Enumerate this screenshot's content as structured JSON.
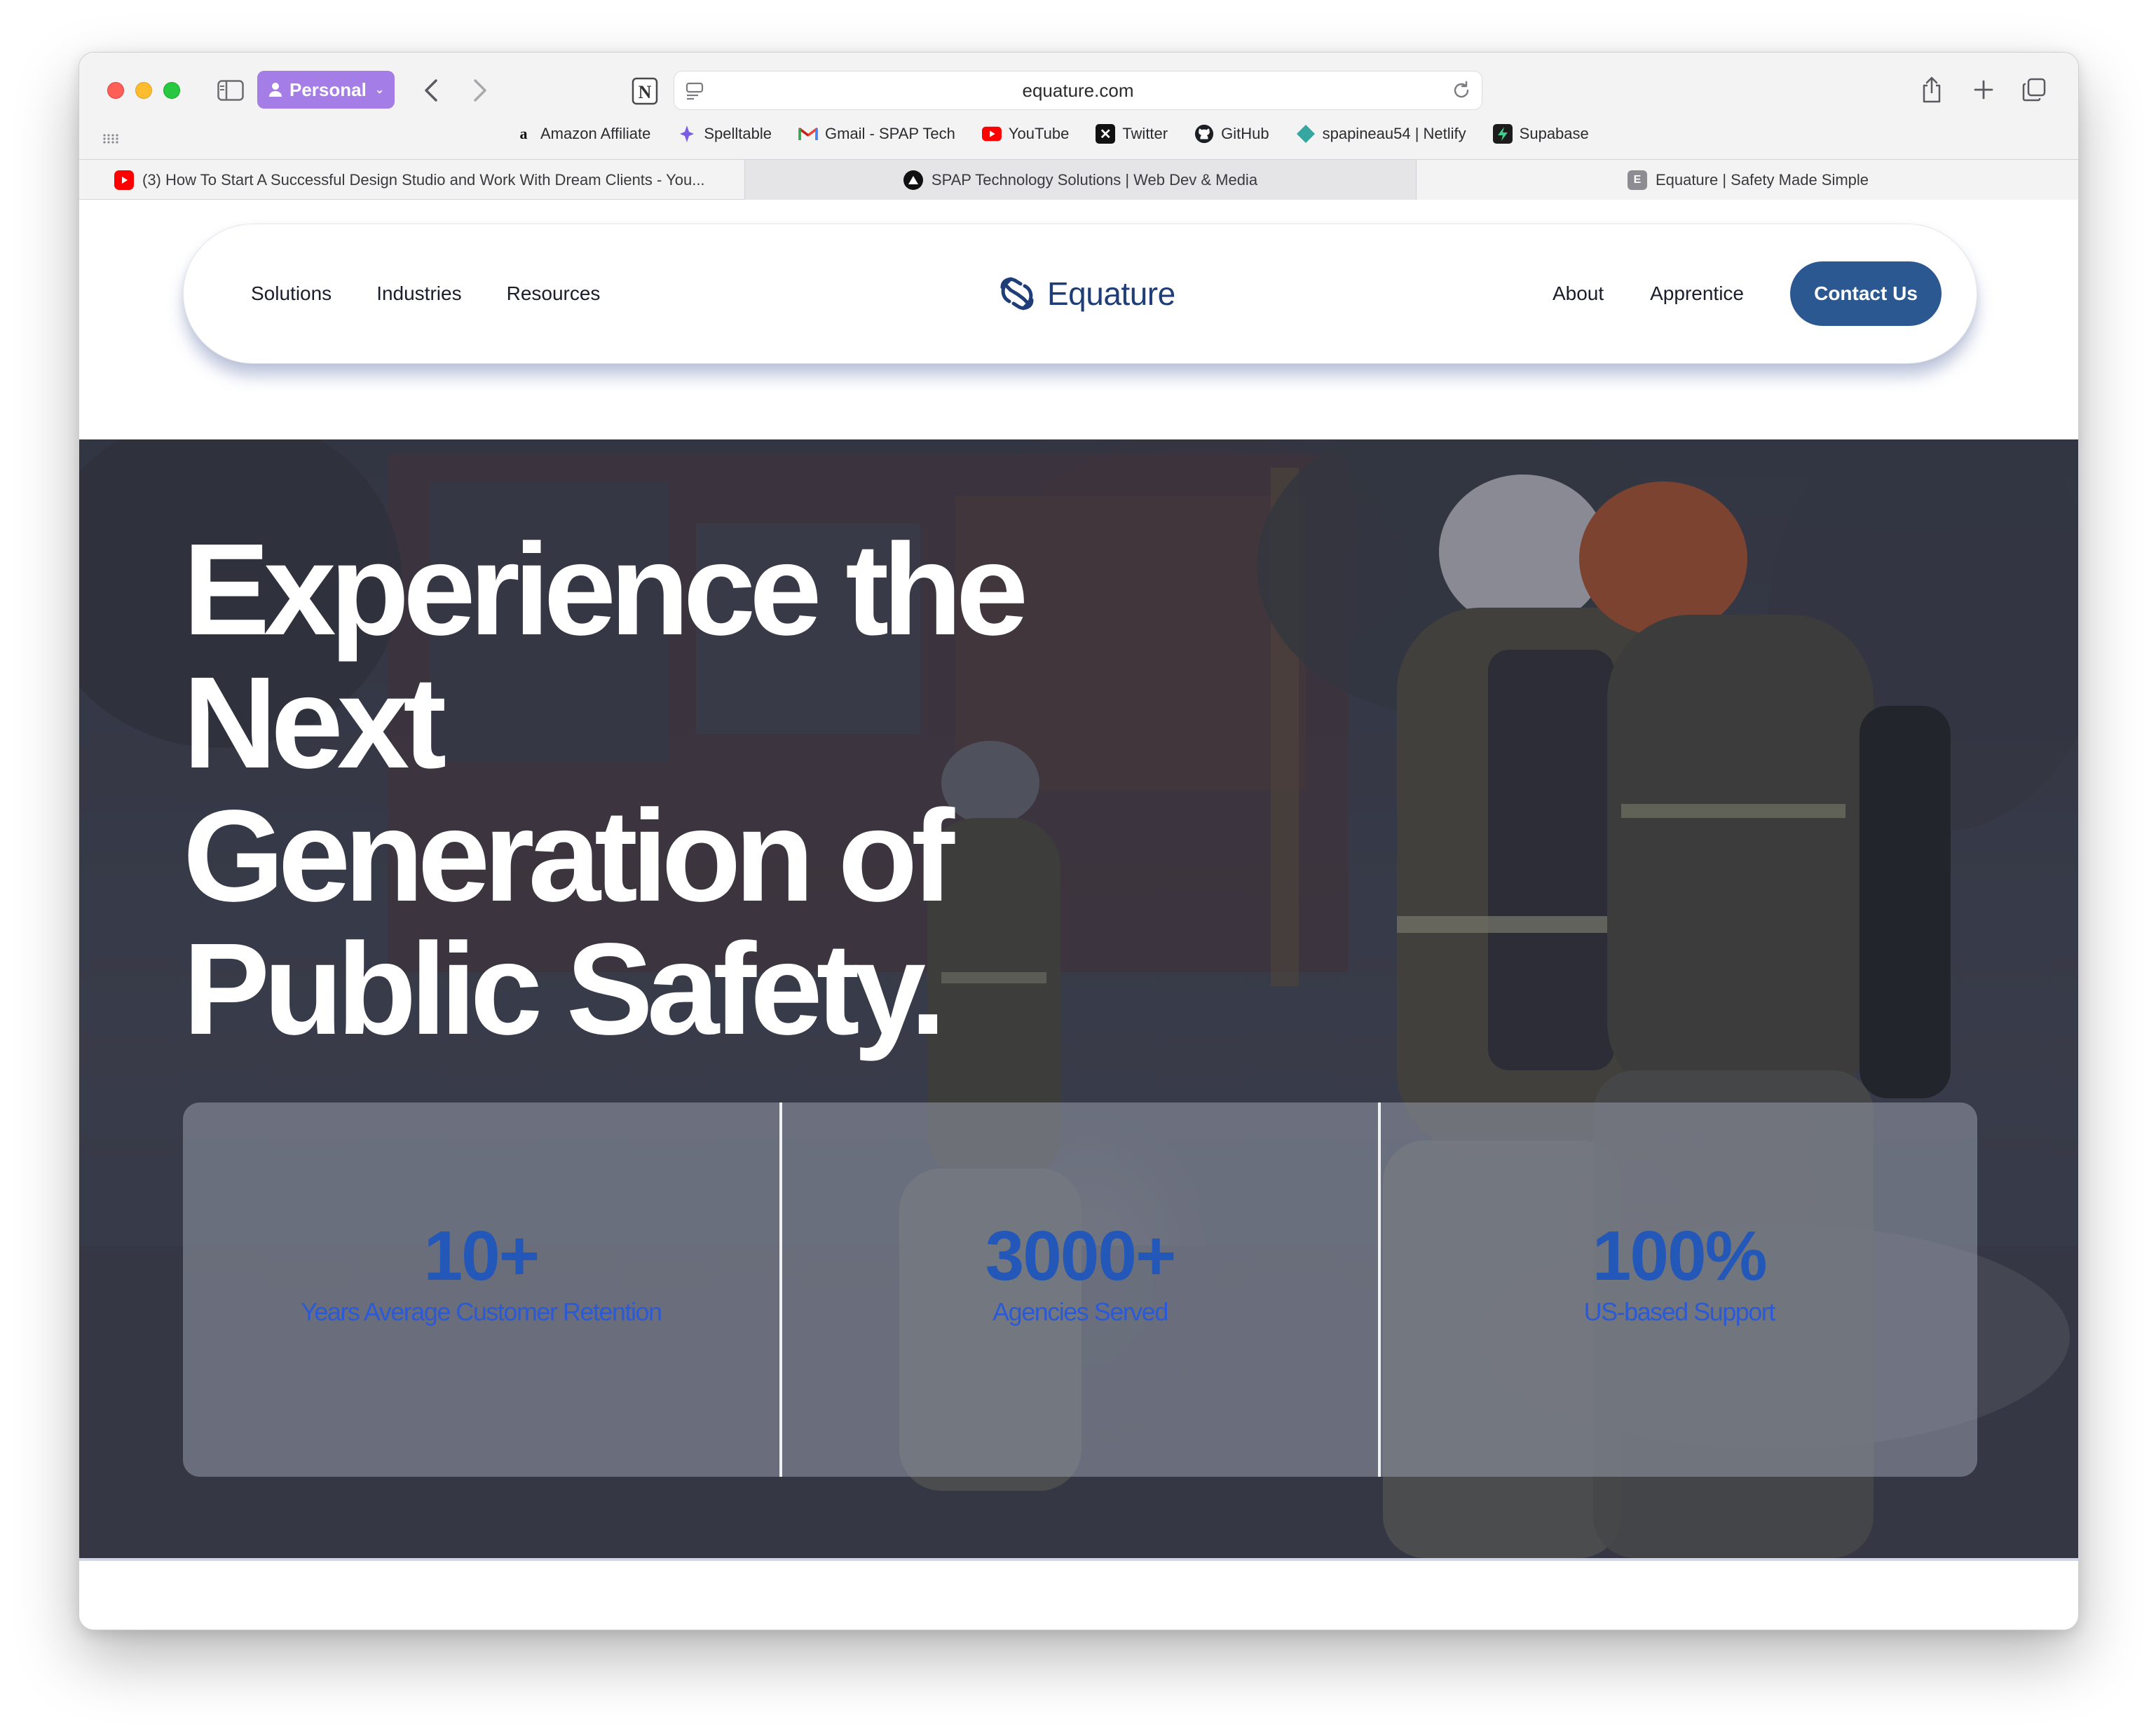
{
  "browser": {
    "profile_label": "Personal",
    "url": "equature.com",
    "bookmarks": [
      {
        "label": "Amazon Affiliate",
        "icon": "amazon-icon"
      },
      {
        "label": "Spelltable",
        "icon": "spelltable-icon"
      },
      {
        "label": "Gmail - SPAP Tech",
        "icon": "gmail-icon"
      },
      {
        "label": "YouTube",
        "icon": "youtube-icon"
      },
      {
        "label": "Twitter",
        "icon": "x-icon"
      },
      {
        "label": "GitHub",
        "icon": "github-icon"
      },
      {
        "label": "spapineau54 | Netlify",
        "icon": "netlify-icon"
      },
      {
        "label": "Supabase",
        "icon": "supabase-icon"
      }
    ],
    "tabs": [
      {
        "label": "(3) How To Start A Successful Design Studio and Work With Dream Clients - You...",
        "icon": "youtube-icon"
      },
      {
        "label": "SPAP Technology Solutions | Web Dev & Media",
        "icon": "spap-icon"
      },
      {
        "label": "Equature | Safety Made Simple",
        "icon": "equature-icon",
        "icon_letter": "E"
      }
    ]
  },
  "site": {
    "nav_left": [
      "Solutions",
      "Industries",
      "Resources"
    ],
    "logo_text": "Equature",
    "nav_right": [
      "About",
      "Apprentice"
    ],
    "cta_label": "Contact Us",
    "colors": {
      "brand": "#2c5891",
      "stat_value": "#2458b8",
      "stat_label": "#2a5ad6"
    }
  },
  "hero": {
    "title_lines": [
      "Experience the",
      "Next",
      "Generation of",
      "Public Safety."
    ],
    "stats": [
      {
        "value": "10+",
        "label": "Years Average Customer Retention"
      },
      {
        "value": "3000+",
        "label": "Agencies Served"
      },
      {
        "value": "100%",
        "label": "US-based Support"
      }
    ]
  }
}
